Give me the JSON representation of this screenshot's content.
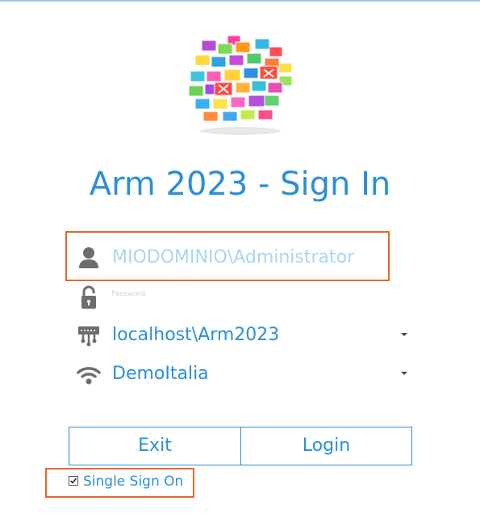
{
  "title": "Arm 2023 - Sign In",
  "login": {
    "username_value": "MIODOMINIO\\Administrator",
    "password_placeholder": "Password",
    "server_value": "localhost\\Arm2023",
    "database_value": "DemoItalia"
  },
  "buttons": {
    "exit_label": "Exit",
    "login_label": "Login"
  },
  "sso": {
    "label": "Single Sign On",
    "checked": true
  },
  "icons": {
    "logo": "colorful-folders-logo",
    "user": "user-icon",
    "password": "lock-icon",
    "server": "server-network-icon",
    "database": "wifi-icon",
    "dropdown": "caret-down-icon"
  },
  "colors": {
    "accent": "#2b8fd6",
    "highlight_border": "#e4672a",
    "icon_gray": "#6d6d6d",
    "username_text": "#a9d5f2"
  }
}
